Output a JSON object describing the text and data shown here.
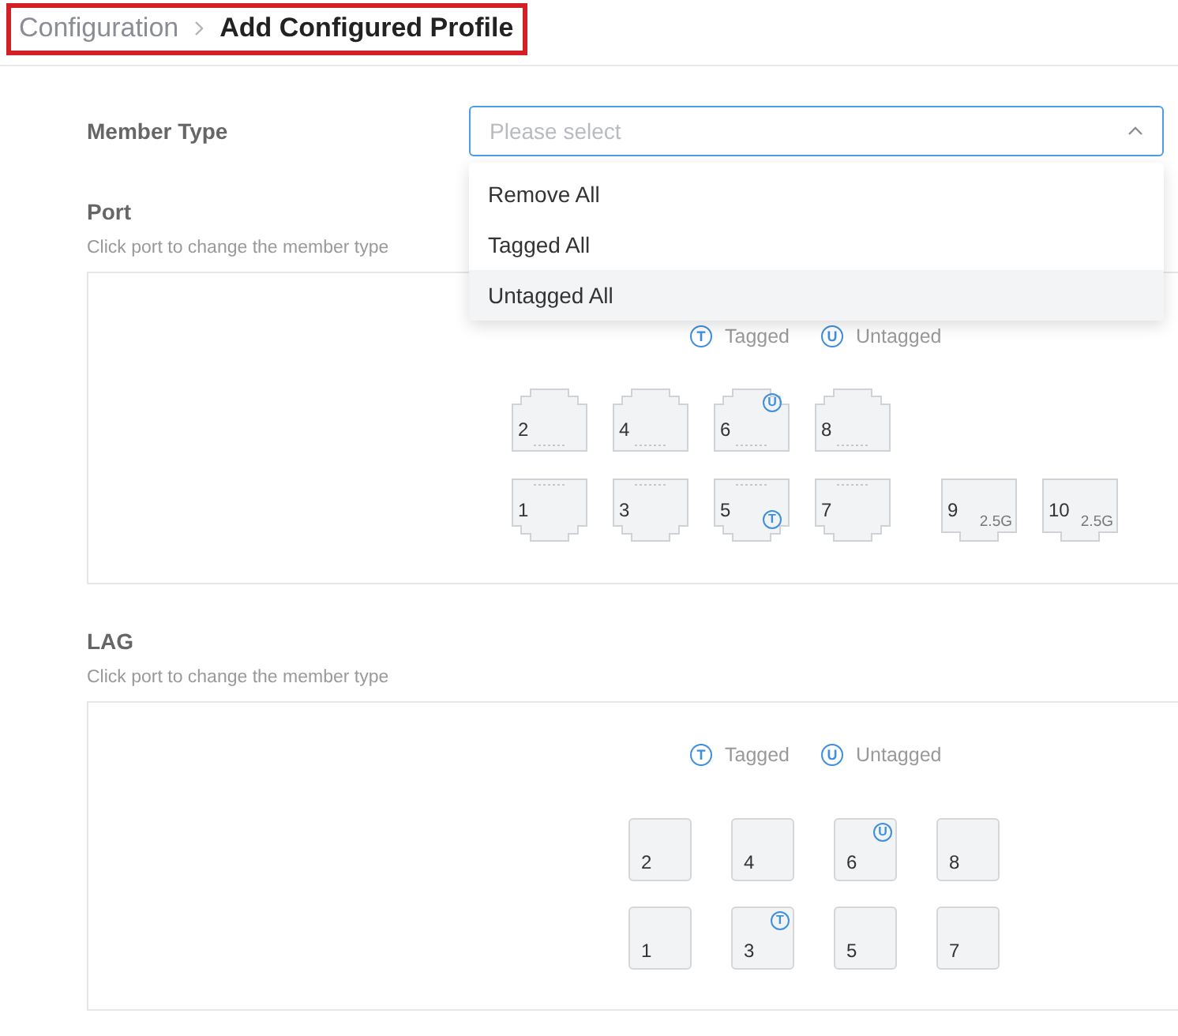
{
  "breadcrumb": {
    "highlighted": true,
    "items": [
      {
        "label": "Configuration",
        "current": false
      },
      {
        "label": "Add Configured Profile",
        "current": true
      }
    ]
  },
  "member_type": {
    "label": "Member Type",
    "placeholder": "Please select",
    "expanded": true,
    "options": [
      {
        "label": "Remove All",
        "selected": false
      },
      {
        "label": "Tagged All",
        "selected": false
      },
      {
        "label": "Untagged All",
        "selected": true
      }
    ]
  },
  "port": {
    "title": "Port",
    "hint": "Click port to change the member type",
    "legend": [
      {
        "badge": "T",
        "label": "Tagged"
      },
      {
        "badge": "U",
        "label": "Untagged"
      }
    ],
    "rows": [
      [
        {
          "label": "2",
          "kind": "rj45"
        },
        {
          "label": "4",
          "kind": "rj45"
        },
        {
          "label": "6",
          "kind": "rj45",
          "badge": "U"
        },
        {
          "label": "8",
          "kind": "rj45"
        }
      ],
      [
        {
          "label": "1",
          "kind": "rj45"
        },
        {
          "label": "3",
          "kind": "rj45"
        },
        {
          "label": "5",
          "kind": "rj45",
          "badge": "T"
        },
        {
          "label": "7",
          "kind": "rj45"
        },
        {
          "label": "9",
          "kind": "sfp",
          "speed": "2.5G"
        },
        {
          "label": "10",
          "kind": "sfp",
          "speed": "2.5G"
        }
      ]
    ]
  },
  "lag": {
    "title": "LAG",
    "hint": "Click port to change the member type",
    "legend": [
      {
        "badge": "T",
        "label": "Tagged"
      },
      {
        "badge": "U",
        "label": "Untagged"
      }
    ],
    "rows": [
      [
        {
          "label": "2",
          "kind": "lag"
        },
        {
          "label": "4",
          "kind": "lag"
        },
        {
          "label": "6",
          "kind": "lag",
          "badge": "U"
        },
        {
          "label": "8",
          "kind": "lag"
        }
      ],
      [
        {
          "label": "1",
          "kind": "lag"
        },
        {
          "label": "3",
          "kind": "lag",
          "badge": "T"
        },
        {
          "label": "5",
          "kind": "lag"
        },
        {
          "label": "7",
          "kind": "lag"
        }
      ]
    ]
  }
}
